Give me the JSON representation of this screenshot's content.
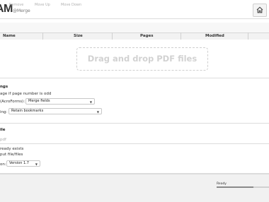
{
  "app": {
    "brand": "AM",
    "brand_sub": "@Merge"
  },
  "header": {
    "home_icon": "home-icon"
  },
  "toolbar": {
    "buttons": [
      "Remove",
      "Move Up",
      "Move Down"
    ]
  },
  "table": {
    "columns": [
      "Name",
      "Size",
      "Pages",
      "Modified"
    ]
  },
  "dropzone": {
    "text": "Drag and drop PDF files here"
  },
  "settings": {
    "title": "ngs",
    "blank_page": "age if page number is odd",
    "acroforms_label": "(AcroForms):",
    "acroforms_value": "Merge fields",
    "bookmarks_label": "ing:",
    "bookmarks_value": "Retain bookmarks"
  },
  "output": {
    "title": "ile",
    "destination_placeholder": "pdf",
    "overwrite": "ready exists",
    "compress": "put file/files",
    "version_label": "on:",
    "version_value": "Version 1.7"
  },
  "footer": {
    "status": "Ready",
    "progress": 0.7
  }
}
